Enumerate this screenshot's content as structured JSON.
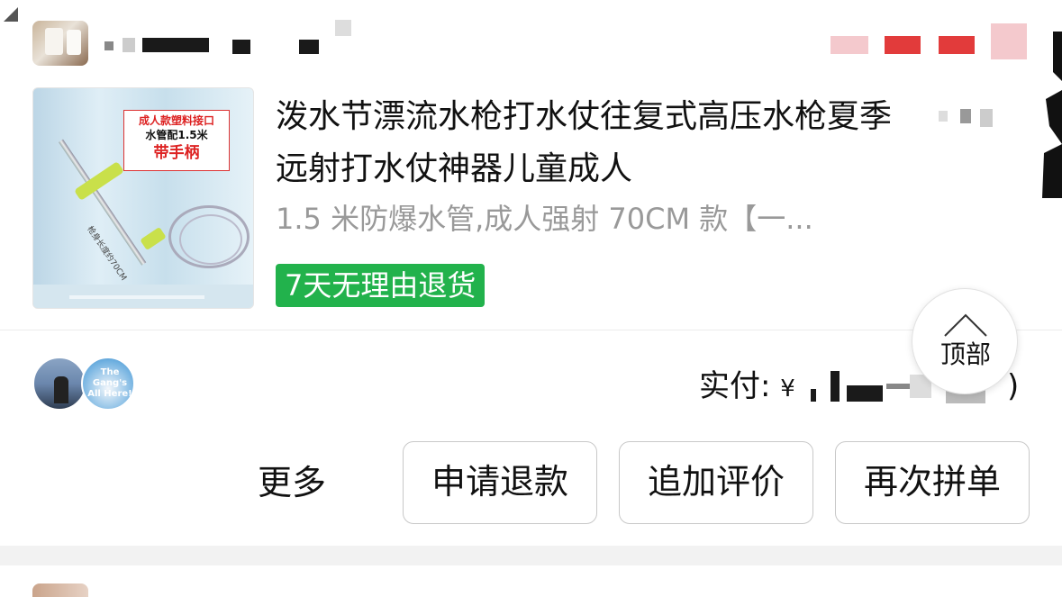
{
  "product": {
    "title": "泼水节漂流水枪打水仗往复式高压水枪夏季远射打水仗神器儿童成人",
    "spec": "1.5 米防爆水管,成人强射 70CM 款【一...",
    "badge": "7天无理由退货",
    "thumb": {
      "label_line1": "成人款塑料接口",
      "label_line2": "水管配1.5米",
      "label_line3": "带手柄",
      "side_text": "枪身长度约70CM"
    }
  },
  "payment": {
    "label": "实付:",
    "currency": "¥",
    "tail": ")"
  },
  "floating": {
    "top_label": "顶部",
    "icon": "chevron-up-icon"
  },
  "actions": {
    "more": "更多",
    "refund": "申请退款",
    "add_review": "追加评价",
    "reorder": "再次拼单"
  },
  "avatars": {
    "second_caption": "The Gang's All Here!"
  },
  "colors": {
    "badge_green": "#22b24c",
    "spec_gray": "#999999",
    "button_border": "#c8c8c8"
  }
}
